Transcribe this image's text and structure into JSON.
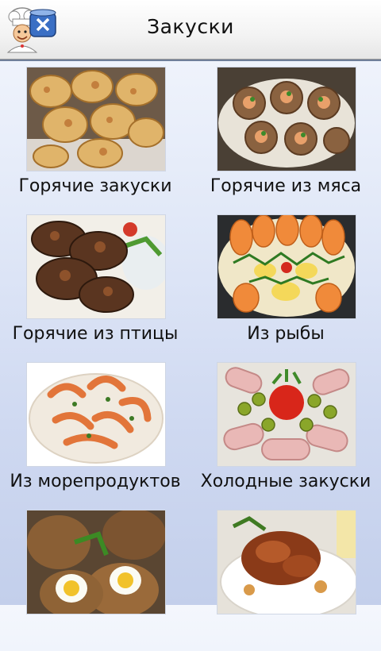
{
  "header": {
    "title": "Закуски",
    "logo_icon": "chef-logo-icon"
  },
  "categories": [
    {
      "label": "Горячие закуски",
      "image": "cheese-baked-rolls-image"
    },
    {
      "label": "Горячие из мяса",
      "image": "meat-tartlets-image"
    },
    {
      "label": "Горячие из птицы",
      "image": "grilled-chicken-wings-image"
    },
    {
      "label": "Из рыбы",
      "image": "salmon-platter-image"
    },
    {
      "label": "Из морепродуктов",
      "image": "shrimp-plate-image"
    },
    {
      "label": "Холодные закуски",
      "image": "ham-rolls-olives-image"
    },
    {
      "label": "",
      "image": "scotch-eggs-image"
    },
    {
      "label": "",
      "image": "roasted-poultry-plate-image"
    }
  ]
}
